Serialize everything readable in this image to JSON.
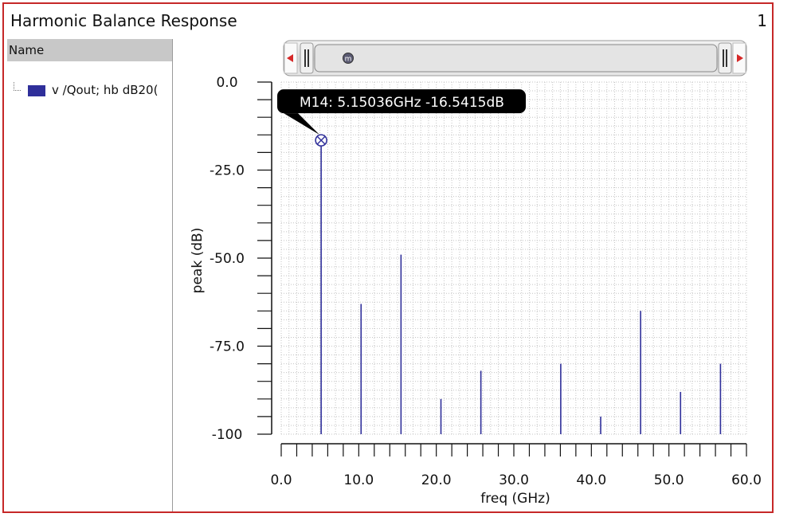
{
  "window": {
    "title": "Harmonic Balance Response",
    "index": "1"
  },
  "legend": {
    "header": "Name",
    "items": [
      {
        "label": "v /Qout; hb dB20(",
        "color": "#2f2f9a"
      }
    ]
  },
  "scrollbar": {
    "marker_label": "m"
  },
  "marker": {
    "label": "M14: 5.15036GHz -16.5415dB",
    "x": 5.15036,
    "y": -16.5415
  },
  "chart_data": {
    "type": "bar",
    "xlabel": "freq (GHz)",
    "ylabel": "peak (dB)",
    "xlim": [
      0,
      60
    ],
    "ylim": [
      -100,
      0
    ],
    "xticks": [
      0,
      10,
      20,
      30,
      40,
      50,
      60
    ],
    "xtick_labels": [
      "0.0",
      "10.0",
      "20.0",
      "30.0",
      "40.0",
      "50.0",
      "60.0"
    ],
    "yticks": [
      0,
      -25,
      -50,
      -75,
      -100
    ],
    "ytick_labels": [
      "0.0",
      "-25.0",
      "-50.0",
      "-75.0",
      "-100"
    ],
    "grid": true,
    "series": [
      {
        "color": "#2f2f9a",
        "points": [
          {
            "x": 5.15,
            "y": -16.5
          },
          {
            "x": 10.3,
            "y": -63
          },
          {
            "x": 15.45,
            "y": -49
          },
          {
            "x": 20.6,
            "y": -90
          },
          {
            "x": 25.75,
            "y": -82
          },
          {
            "x": 36.05,
            "y": -80
          },
          {
            "x": 41.2,
            "y": -95
          },
          {
            "x": 46.35,
            "y": -65
          },
          {
            "x": 51.5,
            "y": -88
          },
          {
            "x": 56.65,
            "y": -80
          }
        ]
      }
    ]
  }
}
